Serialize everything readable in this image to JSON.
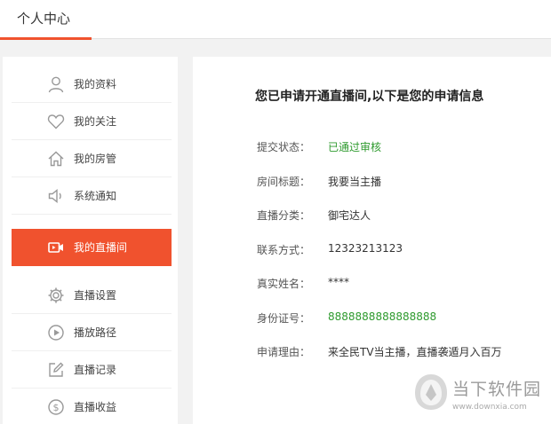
{
  "header": {
    "title": "个人中心",
    "accent_color": "#f0522e"
  },
  "sidebar": {
    "items": [
      {
        "label": "我的资料",
        "icon": "user-icon",
        "active": false
      },
      {
        "label": "我的关注",
        "icon": "heart-icon",
        "active": false
      },
      {
        "label": "我的房管",
        "icon": "home-icon",
        "active": false
      },
      {
        "label": "系统通知",
        "icon": "speaker-icon",
        "active": false
      },
      {
        "label": "我的直播间",
        "icon": "video-camera-icon",
        "active": true
      },
      {
        "label": "直播设置",
        "icon": "gear-icon",
        "active": false
      },
      {
        "label": "播放路径",
        "icon": "play-circle-icon",
        "active": false
      },
      {
        "label": "直播记录",
        "icon": "edit-icon",
        "active": false
      },
      {
        "label": "直播收益",
        "icon": "dollar-circle-icon",
        "active": false
      }
    ]
  },
  "main": {
    "heading": "您已申请开通直播间,以下是您的申请信息",
    "fields": [
      {
        "label": "提交状态：",
        "value": "已通过审核",
        "highlight": true
      },
      {
        "label": "房间标题：",
        "value": "我要当主播",
        "highlight": false
      },
      {
        "label": "直播分类：",
        "value": "御宅达人",
        "highlight": false
      },
      {
        "label": "联系方式：",
        "value": "12323213123",
        "highlight": false
      },
      {
        "label": "真实姓名：",
        "value": "****",
        "highlight": false
      },
      {
        "label": "身份证号：",
        "value": "8888888888888888",
        "highlight": true
      },
      {
        "label": "申请理由：",
        "value": "来全民TV当主播，直播袭遁月入百万",
        "highlight": false
      }
    ]
  },
  "watermark": {
    "name": "当下软件园",
    "url": "www.downxia.com"
  }
}
